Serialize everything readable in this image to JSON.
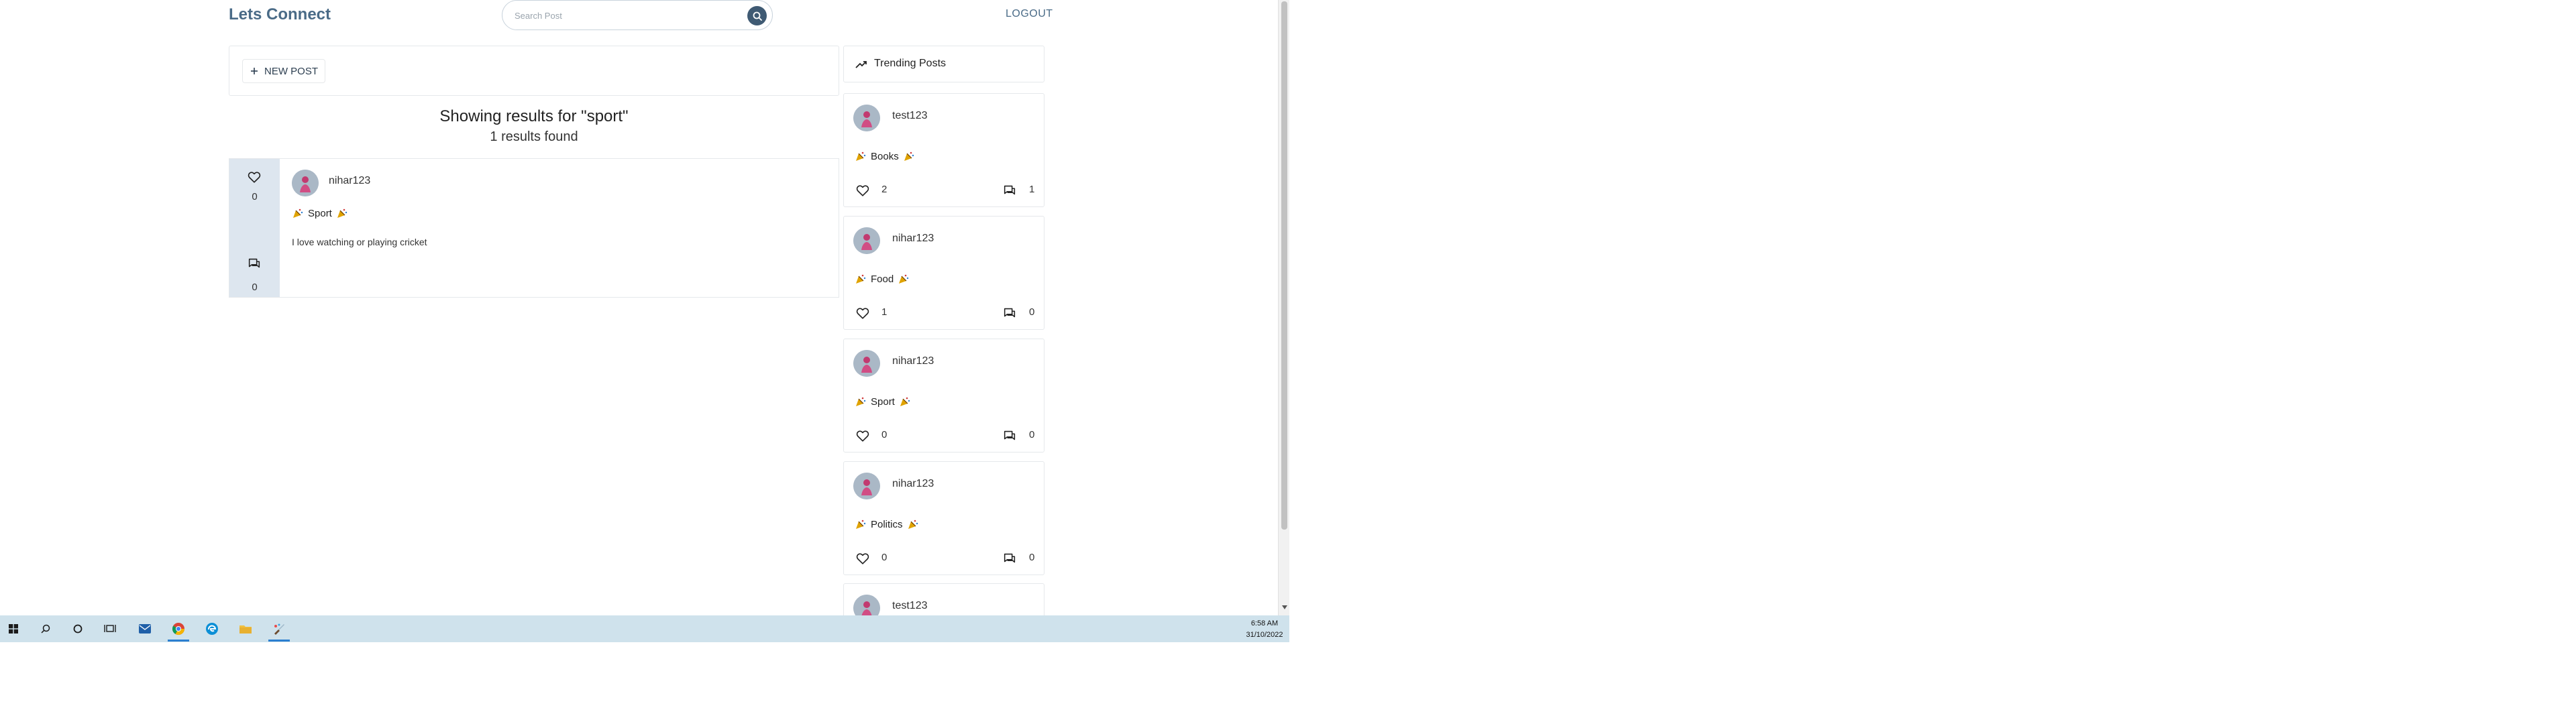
{
  "app": {
    "brand": "Lets Connect",
    "logout_label": "LOGOUT"
  },
  "search": {
    "placeholder": "Search Post",
    "value": ""
  },
  "new_post": {
    "label": "NEW POST"
  },
  "results": {
    "title": "Showing results for \"sport\"",
    "count_text": "1 results found"
  },
  "post": {
    "username": "nihar123",
    "tag": "Sport",
    "body": "I love watching or playing cricket",
    "likes": "0",
    "comments": "0"
  },
  "trending": {
    "title": "Trending Posts",
    "items": [
      {
        "username": "test123",
        "tag": "Books",
        "likes": "2",
        "comments": "1"
      },
      {
        "username": "nihar123",
        "tag": "Food",
        "likes": "1",
        "comments": "0"
      },
      {
        "username": "nihar123",
        "tag": "Sport",
        "likes": "0",
        "comments": "0"
      },
      {
        "username": "nihar123",
        "tag": "Politics",
        "likes": "0",
        "comments": "0"
      },
      {
        "username": "test123"
      }
    ]
  },
  "taskbar": {
    "time": "6:58 AM",
    "date": "31/10/2022",
    "apps": [
      "windows-start-icon",
      "search-icon",
      "cortana-icon",
      "task-view-icon",
      "mail-icon",
      "chrome-icon",
      "edge-icon",
      "file-explorer-icon",
      "paint-icon"
    ]
  },
  "colors": {
    "brand": "#4a6b87",
    "sidebar": "#dde6ef",
    "search_button": "#3f5a73",
    "taskbar": "#cfe2ec"
  }
}
